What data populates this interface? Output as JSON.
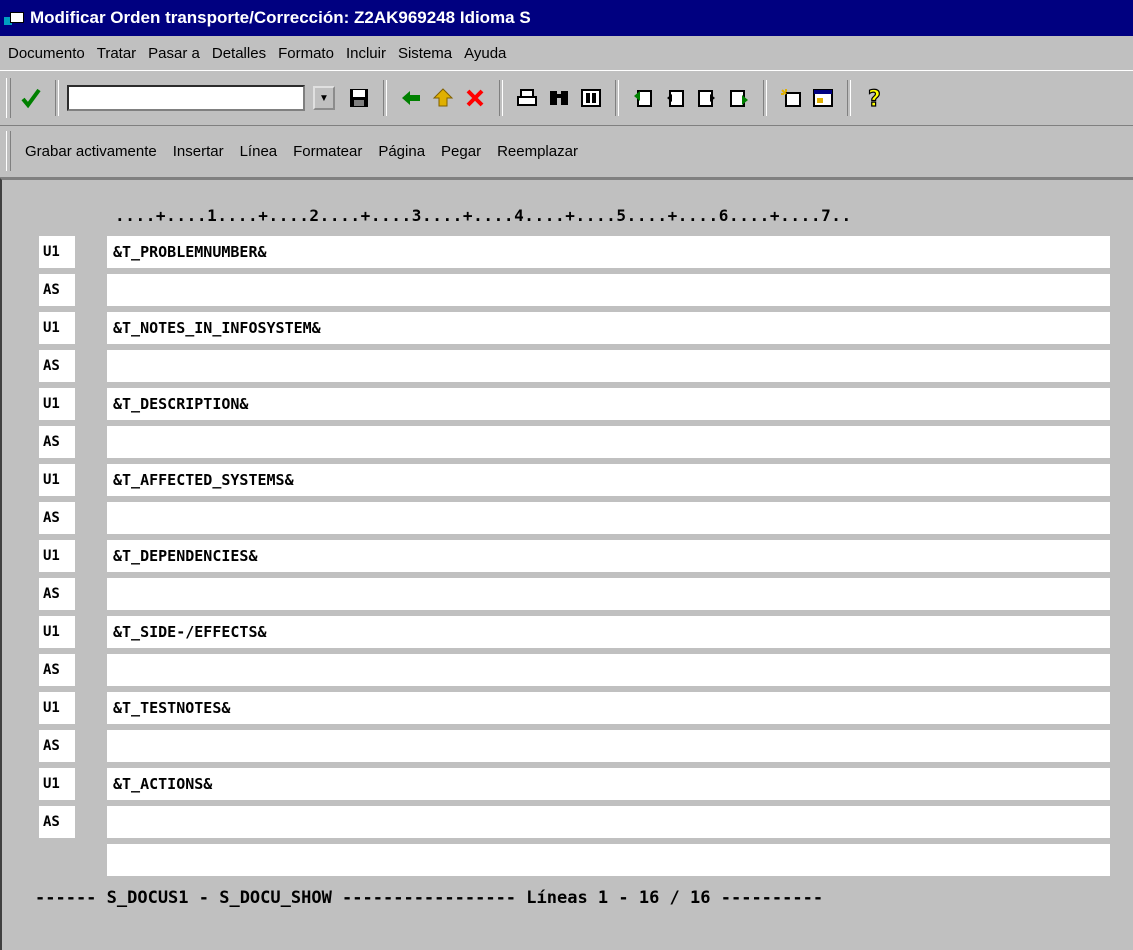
{
  "window": {
    "title": "Modificar Orden transporte/Corrección: Z2AK969248 Idioma S"
  },
  "menu": {
    "items": [
      {
        "label": "Documento"
      },
      {
        "label": "Tratar"
      },
      {
        "label": "Pasar a"
      },
      {
        "label": "Detalles"
      },
      {
        "label": "Formato"
      },
      {
        "label": "Incluir"
      },
      {
        "label": "Sistema"
      },
      {
        "label": "Ayuda"
      }
    ]
  },
  "toolbar": {
    "command_value": "",
    "icons": [
      "check-icon",
      "save-icon",
      "back-icon",
      "up-icon",
      "cancel-icon",
      "print-icon",
      "find-icon",
      "find-next-icon",
      "first-page-icon",
      "previous-page-icon",
      "next-page-icon",
      "last-page-icon",
      "create-session-icon",
      "shortcut-icon",
      "help-icon"
    ],
    "colors": {
      "check": "#008000",
      "back": "#008000",
      "up": "#c09000",
      "cancel": "#ff0000",
      "help": "#ffff00"
    }
  },
  "app_toolbar": {
    "buttons": [
      {
        "label": "Grabar activamente"
      },
      {
        "label": "Insertar"
      },
      {
        "label": "Línea"
      },
      {
        "label": "Formatear"
      },
      {
        "label": "Página"
      },
      {
        "label": "Pegar"
      },
      {
        "label": "Reemplazar"
      }
    ]
  },
  "editor": {
    "ruler": "....+....1....+....2....+....3....+....4....+....5....+....6....+....7..",
    "rows": [
      {
        "tag": "U1",
        "text": "&T_PROBLEMNUMBER&"
      },
      {
        "tag": "AS",
        "text": ""
      },
      {
        "tag": "U1",
        "text": "&T_NOTES_IN_INFOSYSTEM&"
      },
      {
        "tag": "AS",
        "text": ""
      },
      {
        "tag": "U1",
        "text": "&T_DESCRIPTION&"
      },
      {
        "tag": "AS",
        "text": ""
      },
      {
        "tag": "U1",
        "text": "&T_AFFECTED_SYSTEMS&"
      },
      {
        "tag": "AS",
        "text": ""
      },
      {
        "tag": "U1",
        "text": "&T_DEPENDENCIES&"
      },
      {
        "tag": "AS",
        "text": ""
      },
      {
        "tag": "U1",
        "text": "&T_SIDE-/EFFECTS&"
      },
      {
        "tag": "AS",
        "text": ""
      },
      {
        "tag": "U1",
        "text": "&T_TESTNOTES&"
      },
      {
        "tag": "AS",
        "text": ""
      },
      {
        "tag": "U1",
        "text": "&T_ACTIONS&"
      },
      {
        "tag": "AS",
        "text": ""
      },
      {
        "tag": "",
        "text": ""
      }
    ],
    "status_line": "------ S_DOCUS1 - S_DOCU_SHOW ----------------- Líneas 1 - 16 / 16 ----------"
  }
}
